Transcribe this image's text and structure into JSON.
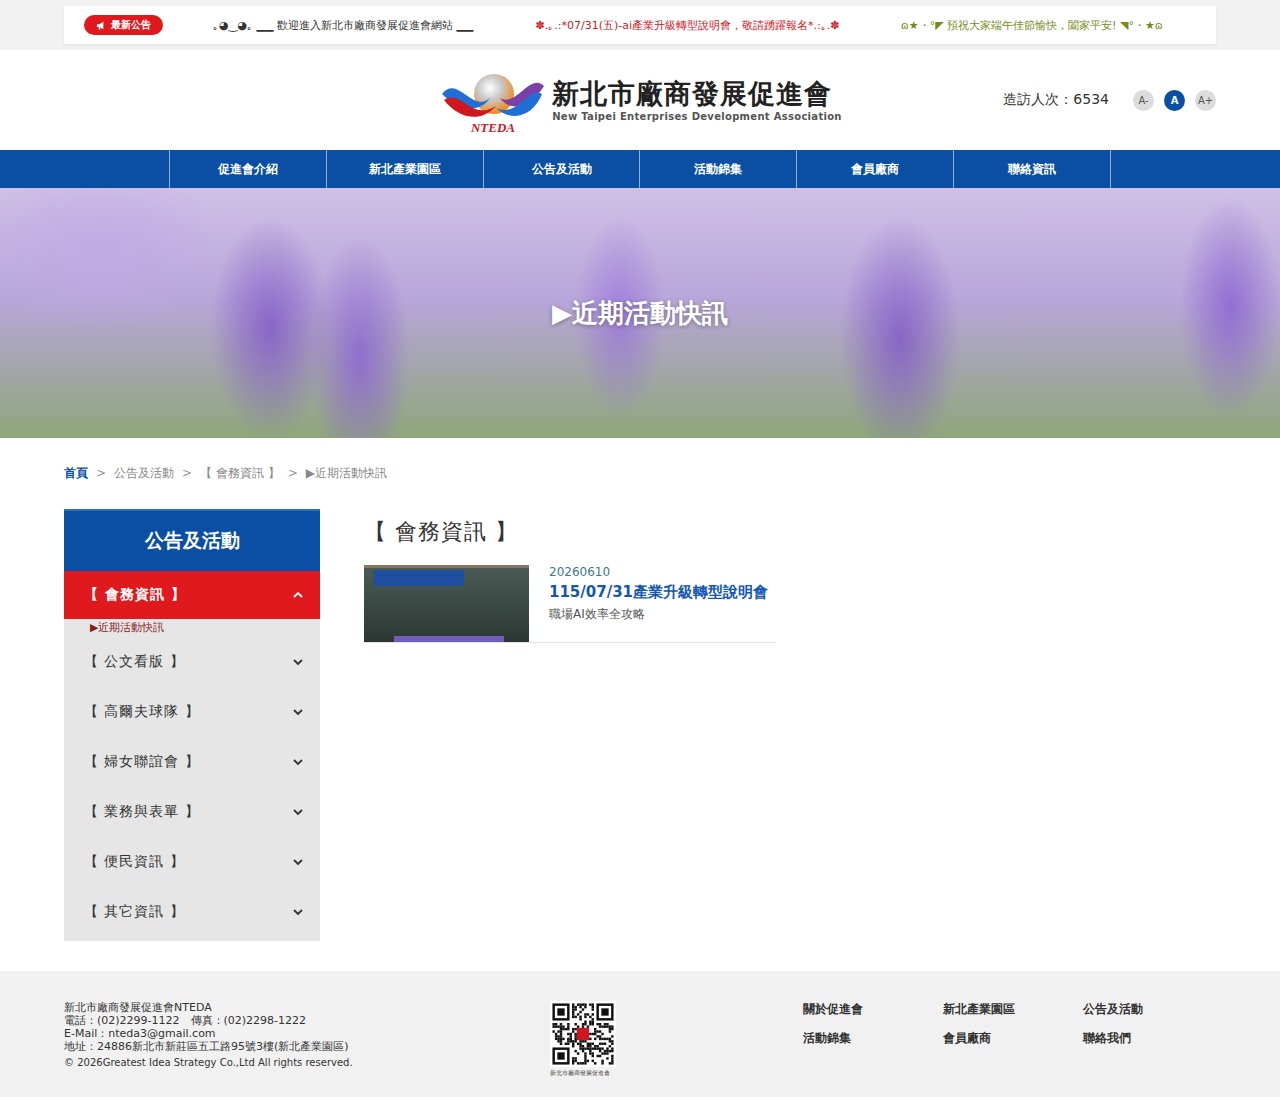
{
  "announcement": {
    "badge": "最新公告",
    "items": [
      {
        "text": "｡◕‿◕｡ ▁▁ 歡迎進入新北市廠商發展促進會網站 ▁▁",
        "color": "#333333"
      },
      {
        "text": "✽.｡.:*07/31(五)-ai產業升級轉型說明會，敬請踴躍報名*.:｡.✽",
        "color": "#d0161e"
      },
      {
        "text": "ɷ★・°◤ 預祝大家端午佳節愉快，闔家平安! ◥°・★ɷ",
        "color": "#7a8a1a"
      }
    ]
  },
  "header": {
    "logo_mark": "NTEDA",
    "title": "新北市廠商發展促進會",
    "subtitle": "New Taipei Enterprises Development Association",
    "visits": "造訪人次：6534",
    "font_sizes": [
      {
        "label": "A-",
        "selected": false
      },
      {
        "label": "A",
        "selected": true
      },
      {
        "label": "A+",
        "selected": false
      }
    ]
  },
  "nav": [
    "促進會介紹",
    "新北產業園區",
    "公告及活動",
    "活動錦集",
    "會員廠商",
    "聯絡資訊"
  ],
  "banner": {
    "title": "▶近期活動快訊"
  },
  "breadcrumb": {
    "separator": ">",
    "items": [
      {
        "label": "首頁",
        "highlighted": true
      },
      {
        "label": "公告及活動",
        "highlighted": false
      },
      {
        "label": "【 會務資訊 】",
        "highlighted": false
      },
      {
        "label": "▶近期活動快訊",
        "highlighted": false
      }
    ]
  },
  "sidebar": {
    "title": "公告及活動",
    "items": [
      {
        "label": "【 會務資訊 】",
        "selected": true,
        "expanded": true,
        "children": [
          "▶近期活動快訊"
        ]
      },
      {
        "label": "【 公文看版 】",
        "selected": false,
        "expanded": false,
        "children": []
      },
      {
        "label": "【 高爾夫球隊 】",
        "selected": false,
        "expanded": false,
        "children": []
      },
      {
        "label": "【 婦女聯誼會 】",
        "selected": false,
        "expanded": false,
        "children": []
      },
      {
        "label": "【 業務與表單 】",
        "selected": false,
        "expanded": false,
        "children": []
      },
      {
        "label": "【 便民資訊 】",
        "selected": false,
        "expanded": false,
        "children": []
      },
      {
        "label": "【 其它資訊 】",
        "selected": false,
        "expanded": false,
        "children": []
      }
    ]
  },
  "content": {
    "title": "【 會務資訊 】",
    "posts": [
      {
        "date": "20260610",
        "title": "115/07/31產業升級轉型說明會",
        "summary": "職場AI效率全攻略"
      }
    ]
  },
  "footer": {
    "lines": [
      "新北市廠商發展促進會NTEDA",
      "電話：(02)2299-1122　傳真：(02)2298-1222",
      "E-Mail：nteda3@gmail.com",
      "地址：24886新北市新莊區五工路95號3樓(新北產業園區)",
      "© 2026Greatest Idea Strategy Co.,Ltd All rights reserved."
    ],
    "qr_caption": "新北市廠商發展促進會",
    "links": [
      "關於促進會",
      "新北產業園區",
      "公告及活動",
      "活動錦集",
      "會員廠商",
      "聯絡我們"
    ]
  }
}
